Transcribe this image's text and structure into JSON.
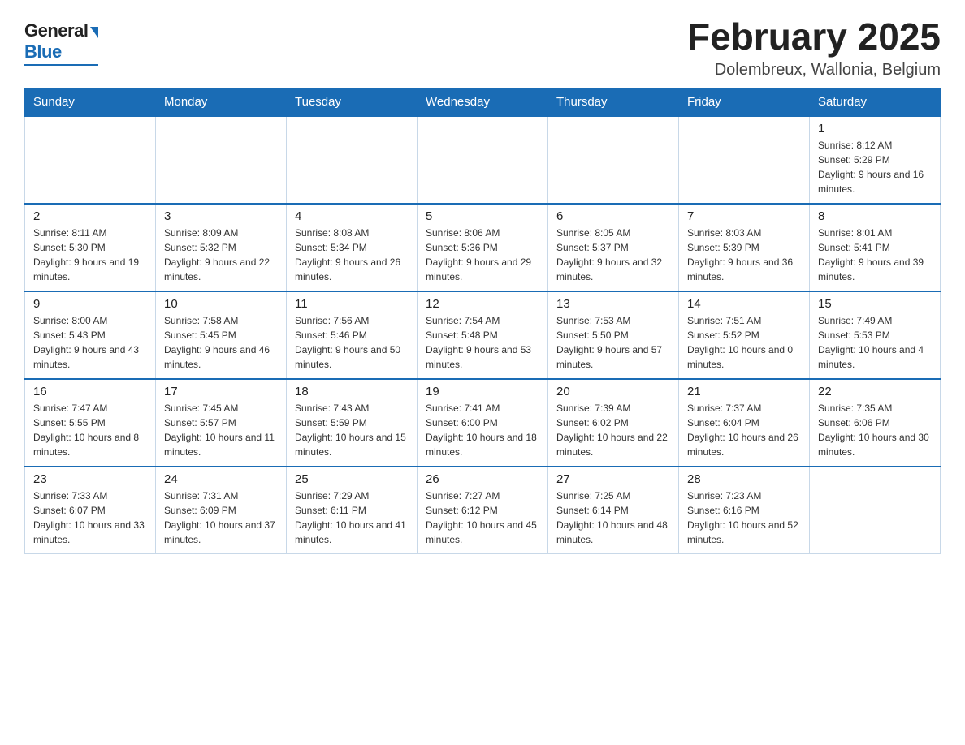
{
  "logo": {
    "general": "General",
    "blue": "Blue"
  },
  "title": {
    "month": "February 2025",
    "location": "Dolembreux, Wallonia, Belgium"
  },
  "days_of_week": [
    "Sunday",
    "Monday",
    "Tuesday",
    "Wednesday",
    "Thursday",
    "Friday",
    "Saturday"
  ],
  "weeks": [
    [
      {
        "day": "",
        "info": ""
      },
      {
        "day": "",
        "info": ""
      },
      {
        "day": "",
        "info": ""
      },
      {
        "day": "",
        "info": ""
      },
      {
        "day": "",
        "info": ""
      },
      {
        "day": "",
        "info": ""
      },
      {
        "day": "1",
        "info": "Sunrise: 8:12 AM\nSunset: 5:29 PM\nDaylight: 9 hours and 16 minutes."
      }
    ],
    [
      {
        "day": "2",
        "info": "Sunrise: 8:11 AM\nSunset: 5:30 PM\nDaylight: 9 hours and 19 minutes."
      },
      {
        "day": "3",
        "info": "Sunrise: 8:09 AM\nSunset: 5:32 PM\nDaylight: 9 hours and 22 minutes."
      },
      {
        "day": "4",
        "info": "Sunrise: 8:08 AM\nSunset: 5:34 PM\nDaylight: 9 hours and 26 minutes."
      },
      {
        "day": "5",
        "info": "Sunrise: 8:06 AM\nSunset: 5:36 PM\nDaylight: 9 hours and 29 minutes."
      },
      {
        "day": "6",
        "info": "Sunrise: 8:05 AM\nSunset: 5:37 PM\nDaylight: 9 hours and 32 minutes."
      },
      {
        "day": "7",
        "info": "Sunrise: 8:03 AM\nSunset: 5:39 PM\nDaylight: 9 hours and 36 minutes."
      },
      {
        "day": "8",
        "info": "Sunrise: 8:01 AM\nSunset: 5:41 PM\nDaylight: 9 hours and 39 minutes."
      }
    ],
    [
      {
        "day": "9",
        "info": "Sunrise: 8:00 AM\nSunset: 5:43 PM\nDaylight: 9 hours and 43 minutes."
      },
      {
        "day": "10",
        "info": "Sunrise: 7:58 AM\nSunset: 5:45 PM\nDaylight: 9 hours and 46 minutes."
      },
      {
        "day": "11",
        "info": "Sunrise: 7:56 AM\nSunset: 5:46 PM\nDaylight: 9 hours and 50 minutes."
      },
      {
        "day": "12",
        "info": "Sunrise: 7:54 AM\nSunset: 5:48 PM\nDaylight: 9 hours and 53 minutes."
      },
      {
        "day": "13",
        "info": "Sunrise: 7:53 AM\nSunset: 5:50 PM\nDaylight: 9 hours and 57 minutes."
      },
      {
        "day": "14",
        "info": "Sunrise: 7:51 AM\nSunset: 5:52 PM\nDaylight: 10 hours and 0 minutes."
      },
      {
        "day": "15",
        "info": "Sunrise: 7:49 AM\nSunset: 5:53 PM\nDaylight: 10 hours and 4 minutes."
      }
    ],
    [
      {
        "day": "16",
        "info": "Sunrise: 7:47 AM\nSunset: 5:55 PM\nDaylight: 10 hours and 8 minutes."
      },
      {
        "day": "17",
        "info": "Sunrise: 7:45 AM\nSunset: 5:57 PM\nDaylight: 10 hours and 11 minutes."
      },
      {
        "day": "18",
        "info": "Sunrise: 7:43 AM\nSunset: 5:59 PM\nDaylight: 10 hours and 15 minutes."
      },
      {
        "day": "19",
        "info": "Sunrise: 7:41 AM\nSunset: 6:00 PM\nDaylight: 10 hours and 18 minutes."
      },
      {
        "day": "20",
        "info": "Sunrise: 7:39 AM\nSunset: 6:02 PM\nDaylight: 10 hours and 22 minutes."
      },
      {
        "day": "21",
        "info": "Sunrise: 7:37 AM\nSunset: 6:04 PM\nDaylight: 10 hours and 26 minutes."
      },
      {
        "day": "22",
        "info": "Sunrise: 7:35 AM\nSunset: 6:06 PM\nDaylight: 10 hours and 30 minutes."
      }
    ],
    [
      {
        "day": "23",
        "info": "Sunrise: 7:33 AM\nSunset: 6:07 PM\nDaylight: 10 hours and 33 minutes."
      },
      {
        "day": "24",
        "info": "Sunrise: 7:31 AM\nSunset: 6:09 PM\nDaylight: 10 hours and 37 minutes."
      },
      {
        "day": "25",
        "info": "Sunrise: 7:29 AM\nSunset: 6:11 PM\nDaylight: 10 hours and 41 minutes."
      },
      {
        "day": "26",
        "info": "Sunrise: 7:27 AM\nSunset: 6:12 PM\nDaylight: 10 hours and 45 minutes."
      },
      {
        "day": "27",
        "info": "Sunrise: 7:25 AM\nSunset: 6:14 PM\nDaylight: 10 hours and 48 minutes."
      },
      {
        "day": "28",
        "info": "Sunrise: 7:23 AM\nSunset: 6:16 PM\nDaylight: 10 hours and 52 minutes."
      },
      {
        "day": "",
        "info": ""
      }
    ]
  ]
}
